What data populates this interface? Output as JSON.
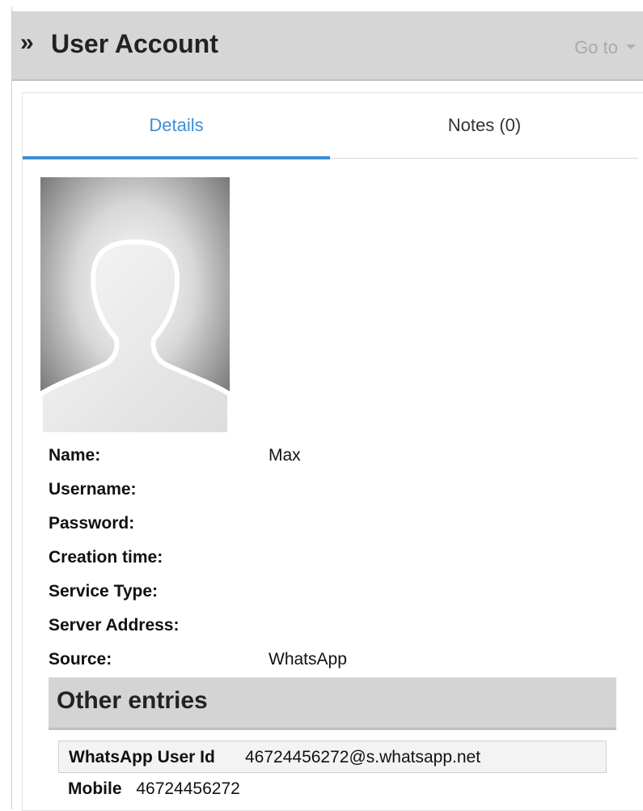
{
  "header": {
    "title": "User Account",
    "goto_label": "Go to",
    "chevron": "»"
  },
  "tabs": [
    {
      "label": "Details",
      "active": true
    },
    {
      "label": "Notes (0)",
      "active": false
    }
  ],
  "avatar": {
    "icon": "user-silhouette-icon"
  },
  "fields": [
    {
      "label": "Name:",
      "value": "Max"
    },
    {
      "label": "Username:",
      "value": ""
    },
    {
      "label": "Password:",
      "value": ""
    },
    {
      "label": "Creation time:",
      "value": ""
    },
    {
      "label": "Service Type:",
      "value": ""
    },
    {
      "label": "Server Address:",
      "value": ""
    },
    {
      "label": "Source:",
      "value": "WhatsApp"
    }
  ],
  "other_entries": {
    "title": "Other entries",
    "items": [
      {
        "label": "WhatsApp User Id",
        "value": "46724456272@s.whatsapp.net"
      },
      {
        "label": "Mobile",
        "value": "46724456272"
      }
    ]
  },
  "colors": {
    "accent": "#3c8fd6",
    "header_bg": "#d6d6d6",
    "section_bg": "#d4d4d4"
  }
}
